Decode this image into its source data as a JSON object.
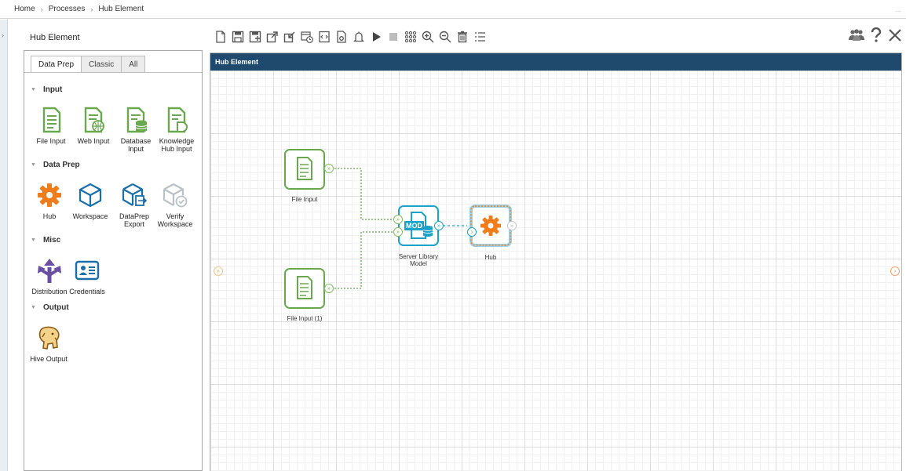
{
  "breadcrumb": {
    "home": "Home",
    "processes": "Processes",
    "current": "Hub Element",
    "more": "..."
  },
  "process_title": "Hub Element",
  "toolbar": {
    "icons": [
      "new-icon",
      "save-icon",
      "save-as-icon",
      "export-icon",
      "import-icon",
      "schedule-icon",
      "code-icon",
      "settings-doc-icon",
      "notification-bell-icon",
      "run-icon",
      "stop-icon",
      "grid-icon",
      "zoom-in-icon",
      "zoom-out-icon",
      "delete-icon",
      "list-icon"
    ],
    "right_icons": [
      "users-icon",
      "help-icon",
      "close-icon"
    ]
  },
  "palette": {
    "tabs": [
      "Data Prep",
      "Classic",
      "All"
    ],
    "active_tab": "Data Prep",
    "sections": {
      "input": "Input",
      "data_prep": "Data Prep",
      "misc": "Misc",
      "output": "Output"
    },
    "tools": {
      "file_input": "File Input",
      "web_input": "Web Input",
      "database_input": "Database Input",
      "knowledge_hub_input": "Knowledge Hub Input",
      "hub": "Hub",
      "workspace": "Workspace",
      "dataprep_export": "DataPrep Export",
      "verify_workspace": "Verify Workspace",
      "distribution": "Distribution",
      "credentials": "Credentials",
      "hive_output": "Hive Output"
    }
  },
  "canvas": {
    "title": "Hub Element",
    "nodes": {
      "file_input": "File Input",
      "file_input_1": "File Input (1)",
      "server_library_model": "Server Library Model",
      "mod_badge": "MOD",
      "hub": "Hub"
    }
  },
  "colors": {
    "header_bg": "#1f4a6e",
    "green": "#6aa84f",
    "teal": "#1aa3c8",
    "orange": "#f07d1b",
    "blue_icon": "#1b6fa8",
    "purple": "#6a4fa3"
  }
}
